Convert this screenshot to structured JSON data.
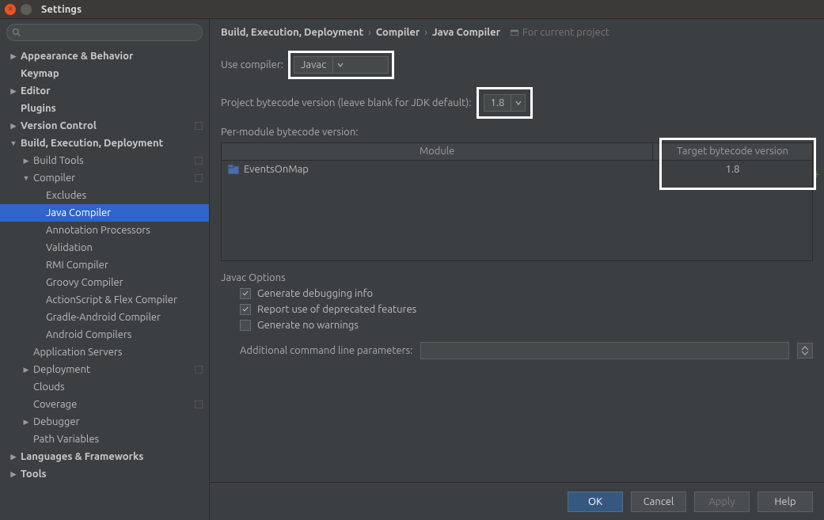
{
  "window": {
    "title": "Settings"
  },
  "search": {
    "placeholder": ""
  },
  "sidebar": {
    "items": [
      {
        "label": "Appearance & Behavior",
        "bold": true,
        "arrow": "▶",
        "indent": 0
      },
      {
        "label": "Keymap",
        "bold": true,
        "arrow": "",
        "indent": 0
      },
      {
        "label": "Editor",
        "bold": true,
        "arrow": "▶",
        "indent": 0
      },
      {
        "label": "Plugins",
        "bold": true,
        "arrow": "",
        "indent": 0
      },
      {
        "label": "Version Control",
        "bold": true,
        "arrow": "▶",
        "indent": 0,
        "proj": true
      },
      {
        "label": "Build, Execution, Deployment",
        "bold": true,
        "arrow": "▼",
        "indent": 0
      },
      {
        "label": "Build Tools",
        "bold": false,
        "arrow": "▶",
        "indent": 1,
        "proj": true
      },
      {
        "label": "Compiler",
        "bold": false,
        "arrow": "▼",
        "indent": 1,
        "proj": true
      },
      {
        "label": "Excludes",
        "bold": false,
        "arrow": "",
        "indent": 2
      },
      {
        "label": "Java Compiler",
        "bold": false,
        "arrow": "",
        "indent": 2,
        "selected": true
      },
      {
        "label": "Annotation Processors",
        "bold": false,
        "arrow": "",
        "indent": 2
      },
      {
        "label": "Validation",
        "bold": false,
        "arrow": "",
        "indent": 2
      },
      {
        "label": "RMI Compiler",
        "bold": false,
        "arrow": "",
        "indent": 2
      },
      {
        "label": "Groovy Compiler",
        "bold": false,
        "arrow": "",
        "indent": 2
      },
      {
        "label": "ActionScript & Flex Compiler",
        "bold": false,
        "arrow": "",
        "indent": 2
      },
      {
        "label": "Gradle-Android Compiler",
        "bold": false,
        "arrow": "",
        "indent": 2
      },
      {
        "label": "Android Compilers",
        "bold": false,
        "arrow": "",
        "indent": 2
      },
      {
        "label": "Application Servers",
        "bold": false,
        "arrow": "",
        "indent": 1
      },
      {
        "label": "Deployment",
        "bold": false,
        "arrow": "▶",
        "indent": 1,
        "proj": true
      },
      {
        "label": "Clouds",
        "bold": false,
        "arrow": "",
        "indent": 1
      },
      {
        "label": "Coverage",
        "bold": false,
        "arrow": "",
        "indent": 1,
        "proj": true
      },
      {
        "label": "Debugger",
        "bold": false,
        "arrow": "▶",
        "indent": 1
      },
      {
        "label": "Path Variables",
        "bold": false,
        "arrow": "",
        "indent": 1
      },
      {
        "label": "Languages & Frameworks",
        "bold": true,
        "arrow": "▶",
        "indent": 0
      },
      {
        "label": "Tools",
        "bold": true,
        "arrow": "▶",
        "indent": 0
      }
    ]
  },
  "breadcrumb": {
    "a": "Build, Execution, Deployment",
    "b": "Compiler",
    "c": "Java Compiler",
    "hint": "For current project"
  },
  "compiler": {
    "use_compiler_label": "Use compiler:",
    "use_compiler_value": "Javac",
    "proj_bytecode_label": "Project bytecode version (leave blank for JDK default):",
    "proj_bytecode_value": "1.8",
    "per_module_label": "Per-module bytecode version:",
    "table": {
      "col_module": "Module",
      "col_target": "Target bytecode version",
      "rows": [
        {
          "module": "EventsOnMap",
          "target": "1.8"
        }
      ]
    }
  },
  "javac": {
    "heading": "Javac Options",
    "gen_debug": "Generate debugging info",
    "report_dep": "Report use of deprecated features",
    "gen_nowarn": "Generate no warnings",
    "addl_label": "Additional command line parameters:",
    "addl_value": ""
  },
  "footer": {
    "ok": "OK",
    "cancel": "Cancel",
    "apply": "Apply",
    "help": "Help"
  }
}
